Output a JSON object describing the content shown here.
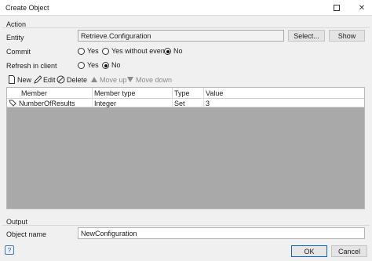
{
  "window": {
    "title": "Create Object"
  },
  "action": {
    "section_label": "Action",
    "entity_label": "Entity",
    "entity_value": "Retrieve.Configuration",
    "select_button": "Select...",
    "show_button": "Show",
    "commit_label": "Commit",
    "commit_options": [
      "Yes",
      "Yes without events",
      "No"
    ],
    "commit_selected": "No",
    "refresh_label": "Refresh in client",
    "refresh_options": [
      "Yes",
      "No"
    ],
    "refresh_selected": "No"
  },
  "toolbar": {
    "new": "New",
    "edit": "Edit",
    "delete": "Delete",
    "move_up": "Move up",
    "move_down": "Move down"
  },
  "members_table": {
    "columns": [
      "Member",
      "Member type",
      "Type",
      "Value"
    ],
    "rows": [
      {
        "member": "NumberOfResults",
        "member_type": "Integer",
        "type": "Set",
        "value": "3"
      }
    ]
  },
  "output": {
    "section_label": "Output",
    "object_name_label": "Object name",
    "object_name_value": "NewConfiguration"
  },
  "footer": {
    "help": "?",
    "ok": "OK",
    "cancel": "Cancel"
  }
}
